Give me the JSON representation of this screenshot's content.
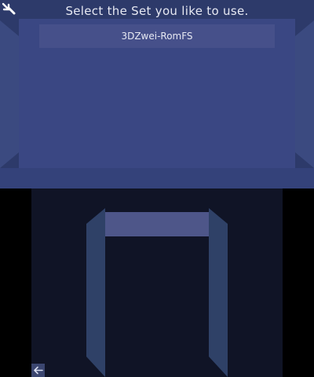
{
  "top_screen": {
    "title": "Select the Set you like to use.",
    "sets": [
      {
        "label": "3DZwei-RomFS",
        "selected": true
      }
    ]
  },
  "icons": {
    "top_left": "hand-pointer-icon",
    "bottom_left": "back-arrow-icon"
  },
  "colors": {
    "top_bg": "#3a4783",
    "top_frame": "#2d3a6a",
    "list_item_bg": "#46508a",
    "bottom_bg": "#101426",
    "bottom_frame": "#2f4167",
    "bottom_bar": "#4e5689",
    "text": "#e6e8f2"
  }
}
